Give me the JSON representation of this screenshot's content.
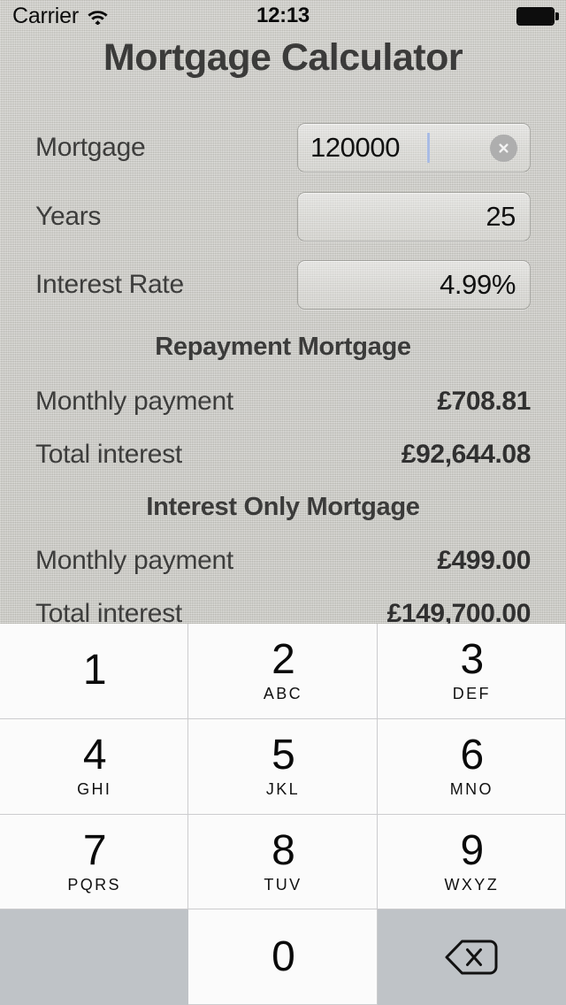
{
  "status_bar": {
    "carrier": "Carrier",
    "wifi_icon": "wifi-icon",
    "time": "12:13",
    "battery_icon": "battery-full-icon"
  },
  "header": {
    "title": "Mortgage Calculator"
  },
  "inputs": [
    {
      "label": "Mortgage",
      "value": "120000",
      "align": "left",
      "has_clear": true,
      "has_caret": true
    },
    {
      "label": "Years",
      "value": "25",
      "align": "right",
      "has_clear": false,
      "has_caret": false
    },
    {
      "label": "Interest Rate",
      "value": "4.99%",
      "align": "right",
      "has_clear": false,
      "has_caret": false
    }
  ],
  "results": [
    {
      "heading": "Repayment Mortgage",
      "rows": [
        {
          "label": "Monthly payment",
          "value": "£708.81"
        },
        {
          "label": "Total interest",
          "value": "£92,644.08"
        }
      ]
    },
    {
      "heading": "Interest Only Mortgage",
      "rows": [
        {
          "label": "Monthly payment",
          "value": "£499.00"
        },
        {
          "label": "Total interest",
          "value": "£149,700.00"
        }
      ]
    }
  ],
  "keypad": {
    "keys": [
      {
        "digit": "1",
        "letters": ""
      },
      {
        "digit": "2",
        "letters": "ABC"
      },
      {
        "digit": "3",
        "letters": "DEF"
      },
      {
        "digit": "4",
        "letters": "GHI"
      },
      {
        "digit": "5",
        "letters": "JKL"
      },
      {
        "digit": "6",
        "letters": "MNO"
      },
      {
        "digit": "7",
        "letters": "PQRS"
      },
      {
        "digit": "8",
        "letters": "TUV"
      },
      {
        "digit": "9",
        "letters": "WXYZ"
      },
      {
        "digit": "",
        "letters": "",
        "blank": true
      },
      {
        "digit": "0",
        "letters": ""
      },
      {
        "digit": "",
        "letters": "",
        "backspace_icon": "backspace-icon"
      }
    ]
  },
  "colors": {
    "background": "#c9c8c3",
    "text_dark": "#3b3b3a",
    "key_face": "#fbfbfb",
    "key_gray": "#bfc3c7",
    "caret": "#a8bbe4",
    "clear_button": "#aeaeae"
  }
}
